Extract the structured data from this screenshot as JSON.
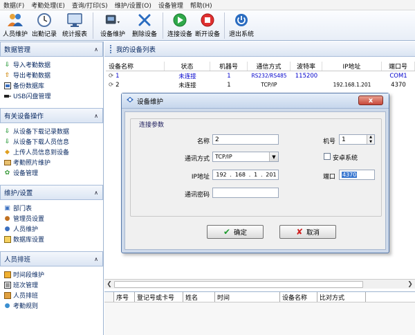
{
  "menubar": [
    "数据(F)",
    "考勤处理(E)",
    "查询/打印(S)",
    "维护/设置(O)",
    "设备管理",
    "帮助(H)"
  ],
  "toolbar": {
    "staff": "人员维护",
    "records": "出勤记录",
    "report": "统计报表",
    "device_maint": "设备维护",
    "delete_device": "删除设备",
    "connect": "连接设备",
    "disconnect": "断开设备",
    "exit": "退出系统"
  },
  "sidebar": {
    "data_mgmt": {
      "title": "数据管理",
      "items": [
        "导入考勤数据",
        "导出考勤数据",
        "备份数据库",
        "USB闪盘管理"
      ]
    },
    "device_ops": {
      "title": "有关设备操作",
      "items": [
        "从设备下载记录数据",
        "从设备下载人员信息",
        "上传人员信息到设备",
        "考勤照片维护",
        "设备管理"
      ]
    },
    "settings": {
      "title": "维护/设置",
      "items": [
        "部门表",
        "管理员设置",
        "人员维护",
        "数据库设置"
      ]
    },
    "schedule": {
      "title": "人员排班",
      "items": [
        "时间段维护",
        "班次管理",
        "人员排班",
        "考勤规则"
      ]
    }
  },
  "main": {
    "title": "我的设备列表",
    "columns": [
      "设备名称",
      "状态",
      "机器号",
      "通信方式",
      "波特率",
      "IP地址",
      "端口号"
    ],
    "rows": [
      [
        "1",
        "未连接",
        "1",
        "RS232/RS485",
        "115200",
        "",
        "COM1"
      ],
      [
        "2",
        "未连接",
        "1",
        "TCP/IP",
        "",
        "192.168.1.201",
        "4370"
      ]
    ],
    "lower_columns": [
      "序号",
      "登记号或卡号",
      "姓名",
      "时间",
      "设备名称",
      "比对方式"
    ]
  },
  "dialog": {
    "title": "设备维护",
    "group": "连接参数",
    "name_label": "名称",
    "name_value": "2",
    "machine_label": "机号",
    "machine_value": "1",
    "comm_label": "通讯方式",
    "comm_value": "TCP/IP",
    "android_label": "安卓系统",
    "ip_label": "IP地址",
    "ip": [
      "192",
      "168",
      "1",
      "201"
    ],
    "port_label": "端口",
    "port_value": "4370",
    "pwd_label": "通讯密码",
    "pwd_value": "",
    "ok": "确定",
    "cancel": "取消",
    "close": "x"
  },
  "colors": {
    "accent": "#0b2b63",
    "link_blue": "#0000cc",
    "header_bg": "#dbe5f3",
    "close_red": "#c8483a"
  }
}
